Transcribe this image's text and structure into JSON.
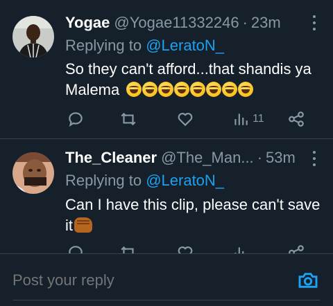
{
  "tweets": [
    {
      "display_name": "Yogae",
      "handle": "@Yogae11332246",
      "separator": "·",
      "time": "23m",
      "replying_prefix": "Replying to",
      "replying_mention": "@LeratoN_",
      "text": "So they can't afford...that shandis ya Malema",
      "emoji": "rolling-on-floor-laughing x8",
      "actions": {
        "reply_count": "",
        "retweet_count": "",
        "like_count": "",
        "views_count": "11"
      }
    },
    {
      "display_name": "The_Cleaner",
      "handle": "@The_Man...",
      "separator": "·",
      "time": "53m",
      "replying_prefix": "Replying to",
      "replying_mention": "@LeratoN_",
      "text": "Can I have this clip, please can't save it",
      "emoji": "raised-fist-medium-dark-skin",
      "actions": {
        "reply_count": "",
        "retweet_count": "",
        "like_count": "",
        "views_count": ""
      }
    }
  ],
  "composer": {
    "placeholder": "Post your reply"
  },
  "colors": {
    "background": "#15202b",
    "accent": "#1da1f2",
    "muted": "#8899a6",
    "divider": "#38444d"
  },
  "icons": [
    "reply-icon",
    "retweet-icon",
    "like-icon",
    "views-icon",
    "share-icon",
    "more-icon",
    "camera-icon"
  ]
}
